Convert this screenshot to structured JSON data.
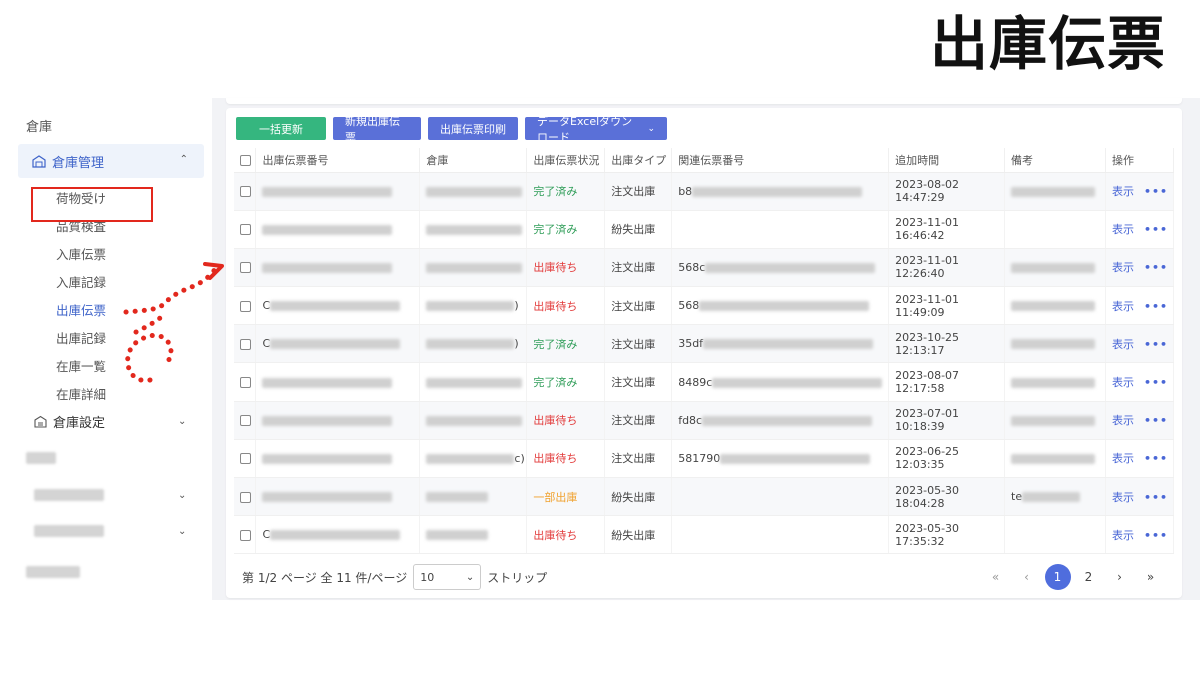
{
  "heading": "出庫伝票",
  "sidebar": {
    "section": "倉庫",
    "group": "倉庫管理",
    "items": [
      "荷物受け",
      "品質検査",
      "入庫伝票",
      "入庫記録",
      "出庫伝票",
      "出庫記録",
      "在庫一覧",
      "在庫詳細"
    ],
    "active_index": 4,
    "group2": "倉庫設定"
  },
  "toolbar": {
    "batch_update": "一括更新",
    "new_slip": "新規出庫伝票",
    "print_slip": "出庫伝票印刷",
    "excel_download": "データExcelダウンロード"
  },
  "table": {
    "headers": [
      "出庫伝票番号",
      "倉庫",
      "出庫伝票状況",
      "出庫タイプ",
      "関連伝票番号",
      "追加時間",
      "備考",
      "操作"
    ],
    "rows": [
      {
        "slip_prefix": "",
        "warehouse_suffix": "",
        "status": "完了済み",
        "status_kind": "done",
        "type": "注文出庫",
        "related_prefix": "b8",
        "time": "2023-08-02 14:47:29",
        "has_related": true,
        "has_note": true
      },
      {
        "slip_prefix": "",
        "warehouse_suffix": "",
        "status": "完了済み",
        "status_kind": "done",
        "type": "紛失出庫",
        "related_prefix": "",
        "time": "2023-11-01 16:46:42",
        "has_related": false,
        "has_note": false
      },
      {
        "slip_prefix": "",
        "warehouse_suffix": "",
        "status": "出庫待ち",
        "status_kind": "wait",
        "type": "注文出庫",
        "related_prefix": "568c",
        "time": "2023-11-01 12:26:40",
        "has_related": true,
        "has_note": true
      },
      {
        "slip_prefix": "C",
        "warehouse_suffix": ")",
        "status": "出庫待ち",
        "status_kind": "wait",
        "type": "注文出庫",
        "related_prefix": "568",
        "time": "2023-11-01 11:49:09",
        "has_related": true,
        "has_note": true
      },
      {
        "slip_prefix": "C",
        "warehouse_suffix": ")",
        "status": "完了済み",
        "status_kind": "done",
        "type": "注文出庫",
        "related_prefix": "35df",
        "time": "2023-10-25 12:13:17",
        "has_related": true,
        "has_note": true
      },
      {
        "slip_prefix": "",
        "warehouse_suffix": "",
        "status": "完了済み",
        "status_kind": "done",
        "type": "注文出庫",
        "related_prefix": "8489c",
        "time": "2023-08-07 12:17:58",
        "has_related": true,
        "has_note": true
      },
      {
        "slip_prefix": "",
        "warehouse_suffix": "",
        "status": "出庫待ち",
        "status_kind": "wait",
        "type": "注文出庫",
        "related_prefix": "fd8c",
        "time": "2023-07-01 10:18:39",
        "has_related": true,
        "has_note": true
      },
      {
        "slip_prefix": "",
        "warehouse_suffix": "c)",
        "status": "出庫待ち",
        "status_kind": "wait",
        "type": "注文出庫",
        "related_prefix": "581790",
        "time": "2023-06-25 12:03:35",
        "has_related": true,
        "has_note": true
      },
      {
        "slip_prefix": "",
        "warehouse_suffix": "",
        "status": "一部出庫",
        "status_kind": "part",
        "type": "紛失出庫",
        "related_prefix": "",
        "time": "2023-05-30 18:04:28",
        "has_related": false,
        "has_note": true,
        "note_prefix": "te"
      },
      {
        "slip_prefix": "C",
        "warehouse_suffix": "",
        "status": "出庫待ち",
        "status_kind": "wait",
        "type": "紛失出庫",
        "related_prefix": "",
        "time": "2023-05-30 17:35:32",
        "has_related": false,
        "has_note": false
      }
    ],
    "action_show": "表示",
    "action_more": "•••"
  },
  "footer": {
    "page_info": "第 1/2 ページ 全 11 件/ページ",
    "page_size": "10",
    "strip": "ストリップ",
    "pages": [
      "1",
      "2"
    ],
    "current_page": "1",
    "first": "«",
    "prev": "‹",
    "next": "›",
    "last": "»"
  },
  "colors": {
    "accent": "#4f6ddd",
    "green": "#35b67f",
    "done": "#2f9d58",
    "wait": "#e23a3a",
    "partial": "#f0a12d",
    "annotation": "#e2281d"
  }
}
